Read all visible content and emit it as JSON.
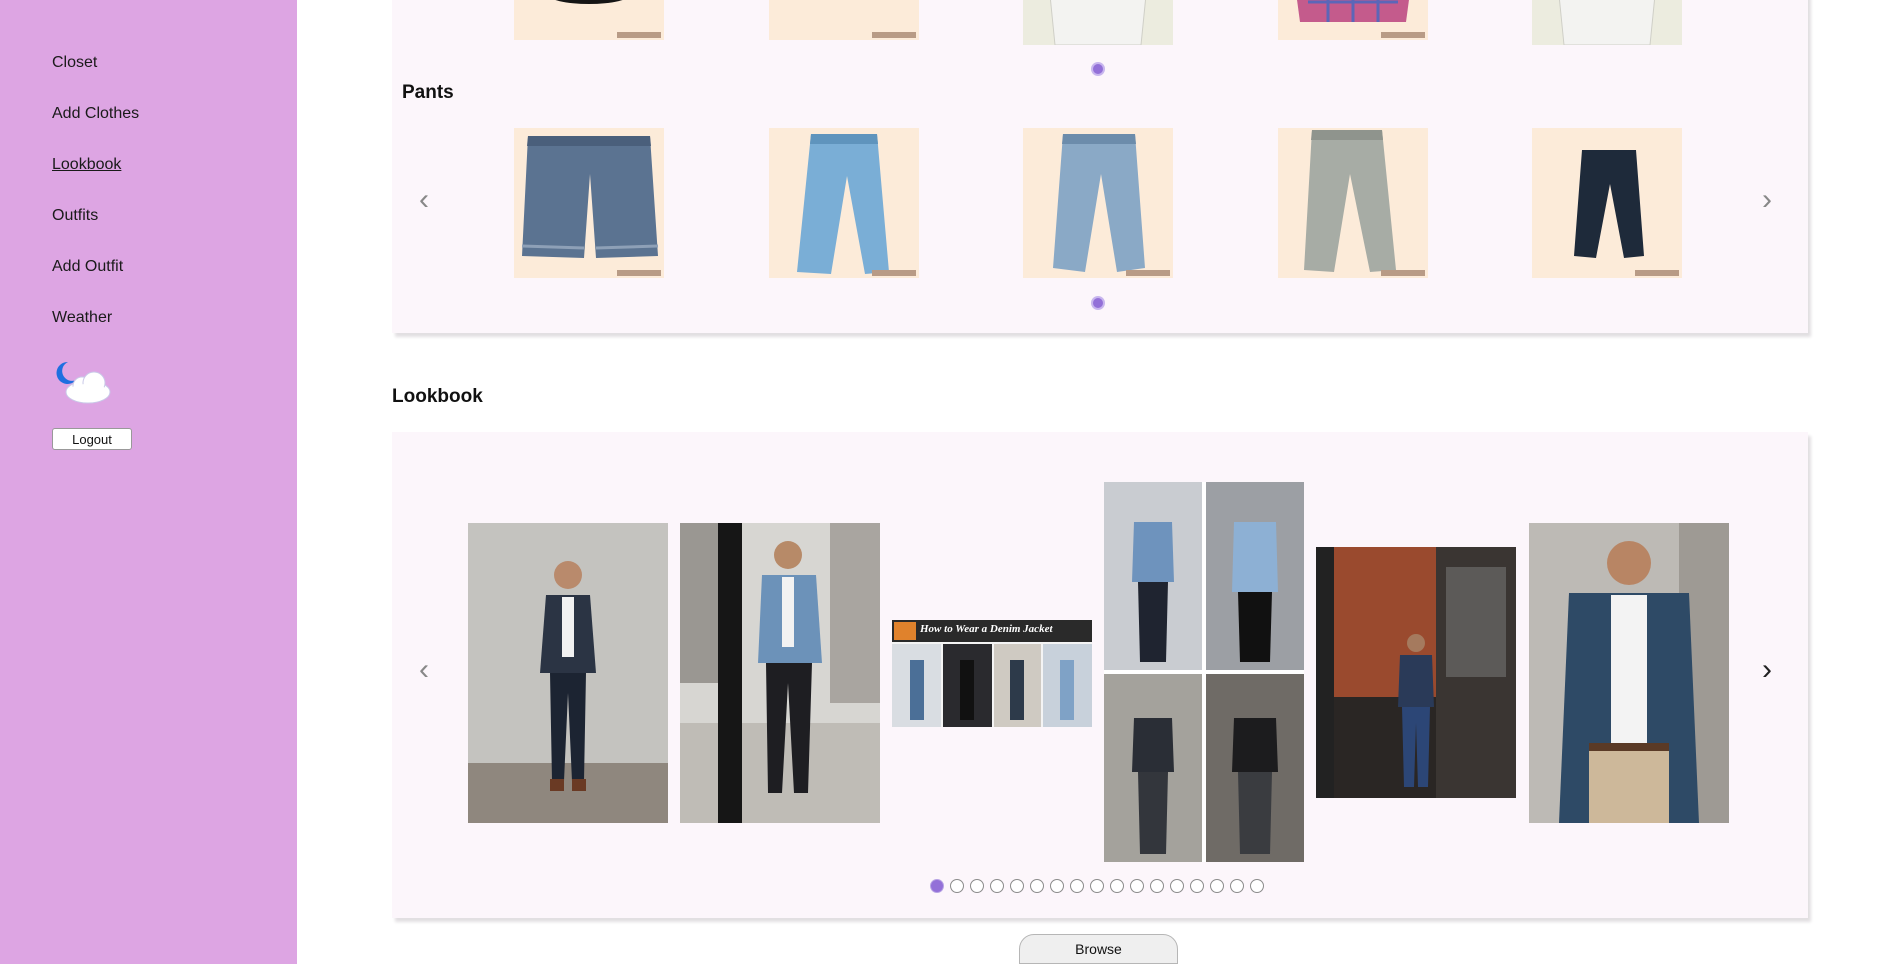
{
  "sidebar": {
    "items": [
      {
        "label": "Closet"
      },
      {
        "label": "Add Clothes"
      },
      {
        "label": "Lookbook"
      },
      {
        "label": "Outfits"
      },
      {
        "label": "Add Outfit"
      },
      {
        "label": "Weather"
      }
    ],
    "active_item": "Lookbook",
    "weather_icon": "moon-cloud-icon",
    "logout_label": "Logout"
  },
  "pants_section": {
    "title": "Pants",
    "prev_arrow": "‹",
    "next_arrow": "›"
  },
  "lookbook": {
    "title": "Lookbook",
    "prev_arrow": "‹",
    "next_arrow": "›",
    "banner_text": "How to Wear a Denim Jacket",
    "page_count": 17,
    "active_page": 1
  },
  "browse_label": "Browse",
  "colors": {
    "sidebar_bg": "#dda5e3",
    "panel_bg": "#fcf6fb",
    "garment_bg": "#fcebd9",
    "dot_active": "#9370d8"
  }
}
